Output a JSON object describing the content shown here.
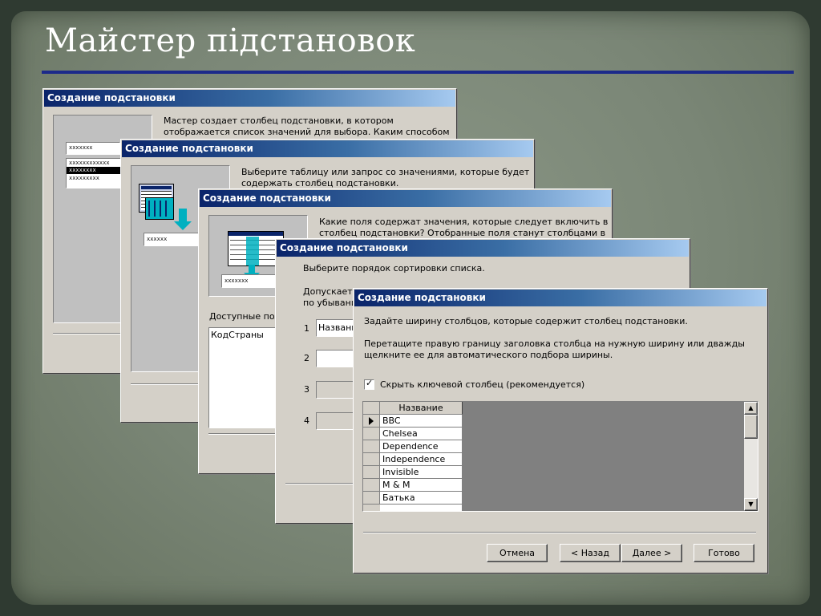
{
  "slide": {
    "title": "Майстер підстановок"
  },
  "dialog_title": "Создание подстановки",
  "step1": {
    "text_line1": "Мастер создает столбец подстановки, в котором",
    "text_line2": "отображается список значений для выбора.  Каким способом",
    "mini_items": [
      "ххххххх",
      "хххххххххххх",
      "хххххххх",
      "ххххххххх"
    ]
  },
  "step2": {
    "text_line1": "Выберите таблицу или запрос со значениями, которые будет",
    "text_line2": "содержать столбец подстановки.",
    "mini_value": "хххххх"
  },
  "step3": {
    "text_line1": "Какие поля содержат значения, которые следует включить в",
    "text_line2": "столбец подстановки? Отобранные поля станут столбцами в",
    "mini_value": "ххххххх",
    "available_label": "Доступные поля:",
    "list_item": "КодСтраны"
  },
  "step4": {
    "text_line1": "Выберите порядок сортировки списка.",
    "text_line2": "Допускается",
    "text_line3": "по убыванию",
    "sort_rows": [
      {
        "num": "1",
        "value": "Название"
      },
      {
        "num": "2",
        "value": ""
      },
      {
        "num": "3",
        "value": ""
      },
      {
        "num": "4",
        "value": ""
      }
    ]
  },
  "step5": {
    "text_line1": "Задайте ширину столбцов, которые содержит столбец подстановки.",
    "text_line2": "Перетащите правую границу заголовка столбца на нужную ширину или дважды",
    "text_line3": "щелкните ее для автоматического подбора ширины.",
    "checkbox_label": "Скрыть ключевой столбец (рекомендуется)",
    "checkbox_checked": true,
    "column_header": "Название",
    "rows": [
      "BBC",
      "Chelsea",
      "Dependence",
      "Independence",
      "Invisible",
      "M & M",
      "Батька"
    ],
    "buttons": {
      "cancel": "Отмена",
      "back": "< Назад",
      "next": "Далее >",
      "finish": "Готово"
    }
  }
}
